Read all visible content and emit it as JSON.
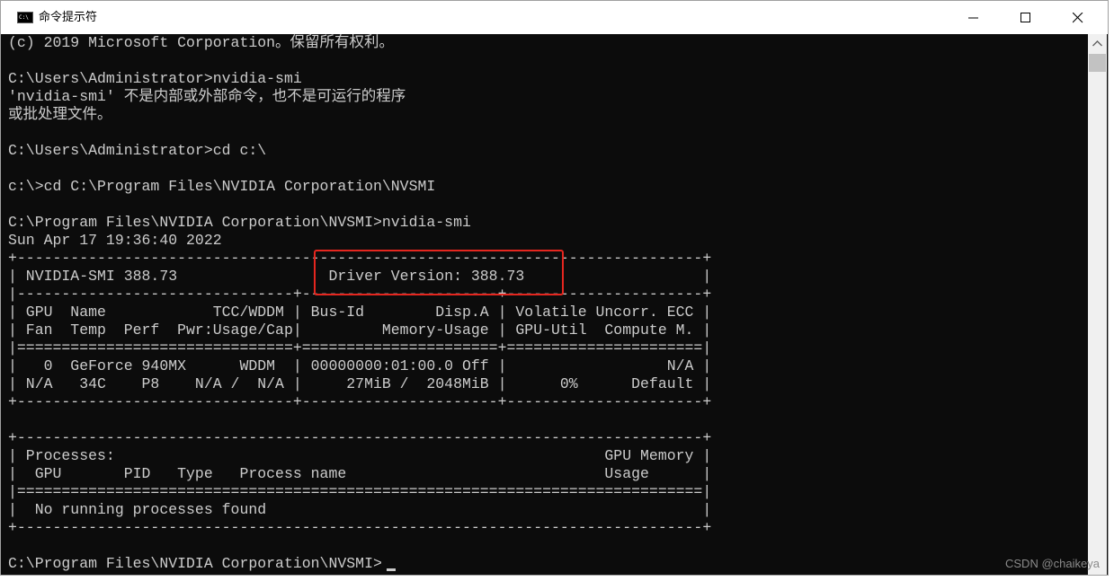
{
  "window": {
    "title": "命令提示符",
    "icon": "console-app-icon",
    "icon_text": "C:\\",
    "controls": [
      "minimize-icon",
      "maximize-icon",
      "close-icon"
    ]
  },
  "console": {
    "lines": [
      "(c) 2019 Microsoft Corporation。保留所有权利。",
      "",
      "C:\\Users\\Administrator>nvidia-smi",
      "'nvidia-smi' 不是内部或外部命令，也不是可运行的程序",
      "或批处理文件。",
      "",
      "C:\\Users\\Administrator>cd c:\\",
      "",
      "c:\\>cd C:\\Program Files\\NVIDIA Corporation\\NVSMI",
      "",
      "C:\\Program Files\\NVIDIA Corporation\\NVSMI>nvidia-smi",
      "Sun Apr 17 19:36:40 2022",
      "+-----------------------------------------------------------------------------+",
      "| NVIDIA-SMI 388.73                 Driver Version: 388.73                    |",
      "|-------------------------------+----------------------+----------------------+",
      "| GPU  Name            TCC/WDDM | Bus-Id        Disp.A | Volatile Uncorr. ECC |",
      "| Fan  Temp  Perf  Pwr:Usage/Cap|         Memory-Usage | GPU-Util  Compute M. |",
      "|===============================+======================+======================|",
      "|   0  GeForce 940MX      WDDM  | 00000000:01:00.0 Off |                  N/A |",
      "| N/A   34C    P8    N/A /  N/A |     27MiB /  2048MiB |      0%      Default |",
      "+-------------------------------+----------------------+----------------------+",
      "",
      "+-----------------------------------------------------------------------------+",
      "| Processes:                                                       GPU Memory |",
      "|  GPU       PID   Type   Process name                             Usage      |",
      "|=============================================================================|",
      "|  No running processes found                                                 |",
      "+-----------------------------------------------------------------------------+",
      "",
      "C:\\Program Files\\NVIDIA Corporation\\NVSMI>"
    ],
    "text_color": "#cccccc",
    "background_color": "#0c0c0c"
  },
  "annotation": {
    "highlight_color": "#e5261f",
    "target": "Driver Version: 388.73"
  },
  "watermark": "CSDN @chaikeya"
}
